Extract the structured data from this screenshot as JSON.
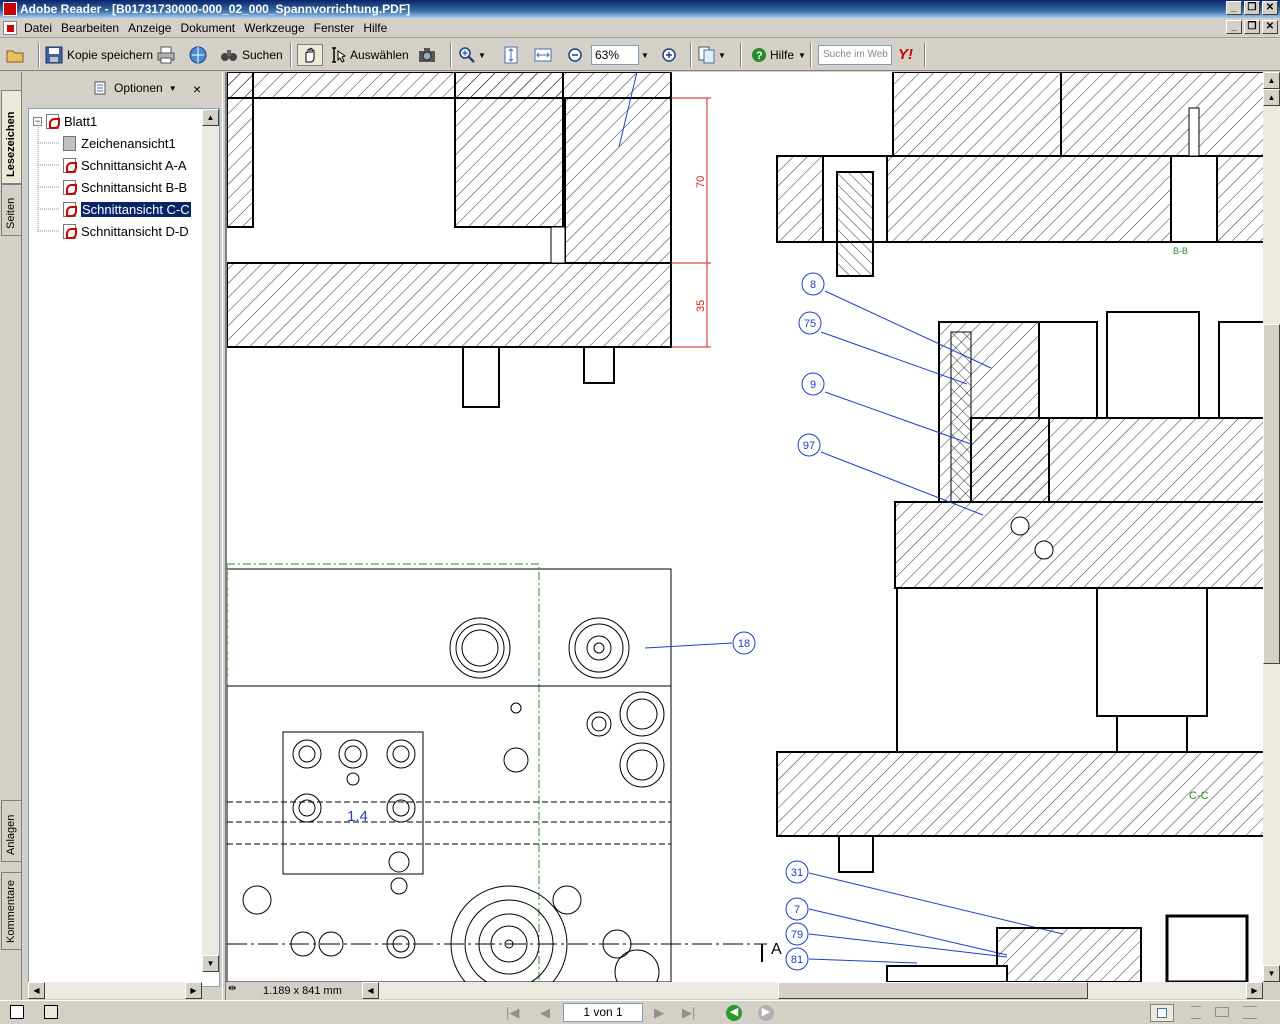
{
  "window": {
    "title": "Adobe Reader - [B01731730000-000_02_000_Spannvorrichtung.PDF]"
  },
  "menu": {
    "items": [
      "Datei",
      "Bearbeiten",
      "Anzeige",
      "Dokument",
      "Werkzeuge",
      "Fenster",
      "Hilfe"
    ]
  },
  "toolbar": {
    "save_copy_label": "Kopie speichern",
    "search_label": "Suchen",
    "select_label": "Auswählen",
    "zoom_value": "63%",
    "help_label": "Hilfe",
    "search_web_placeholder": "Suche im Web",
    "yahoo_label": "Y!"
  },
  "nav_tabs": {
    "bookmarks": "Lesezeichen",
    "pages": "Seiten",
    "attachments": "Anlagen",
    "comments": "Kommentare"
  },
  "bookmarks_panel": {
    "options_label": "Optionen",
    "close_label": "×",
    "root": "Blatt1",
    "items": [
      "Zeichenansicht1",
      "Schnittansicht A-A",
      "Schnittansicht B-B",
      "Schnittansicht C-C",
      "Schnittansicht D-D"
    ],
    "selected_index": 3
  },
  "document": {
    "page_size": "1.189 x 841 mm",
    "dimension_labels": [
      "70",
      "35"
    ],
    "balloons": [
      "8",
      "75",
      "9",
      "97",
      "18",
      "31",
      "7",
      "79",
      "81"
    ],
    "view_labels": [
      "B-B",
      "C-C",
      "1.4",
      "A"
    ]
  },
  "status": {
    "page_indicator": "1 von 1"
  }
}
